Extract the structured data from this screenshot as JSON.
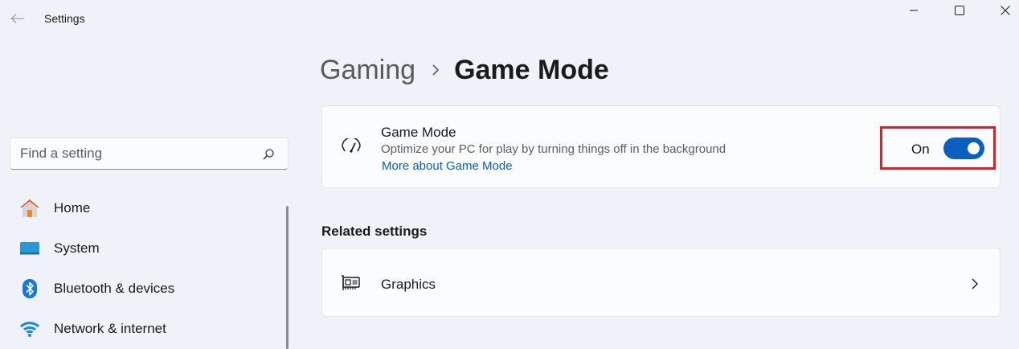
{
  "window": {
    "title": "Settings"
  },
  "search": {
    "placeholder": "Find a setting"
  },
  "sidebar": {
    "items": [
      {
        "label": "Home",
        "icon": "home-icon"
      },
      {
        "label": "System",
        "icon": "system-icon"
      },
      {
        "label": "Bluetooth & devices",
        "icon": "bluetooth-icon"
      },
      {
        "label": "Network & internet",
        "icon": "network-icon"
      }
    ]
  },
  "breadcrumb": {
    "parent": "Gaming",
    "current": "Game Mode"
  },
  "game_mode": {
    "title": "Game Mode",
    "description": "Optimize your PC for play by turning things off in the background",
    "link": "More about Game Mode",
    "toggle_label": "On",
    "toggle_state": true
  },
  "related": {
    "heading": "Related settings",
    "items": [
      {
        "label": "Graphics",
        "icon": "graphics-card-icon"
      }
    ]
  },
  "colors": {
    "accent": "#0b5fbf",
    "highlight": "#e01e28",
    "link": "#0a5eb5"
  }
}
